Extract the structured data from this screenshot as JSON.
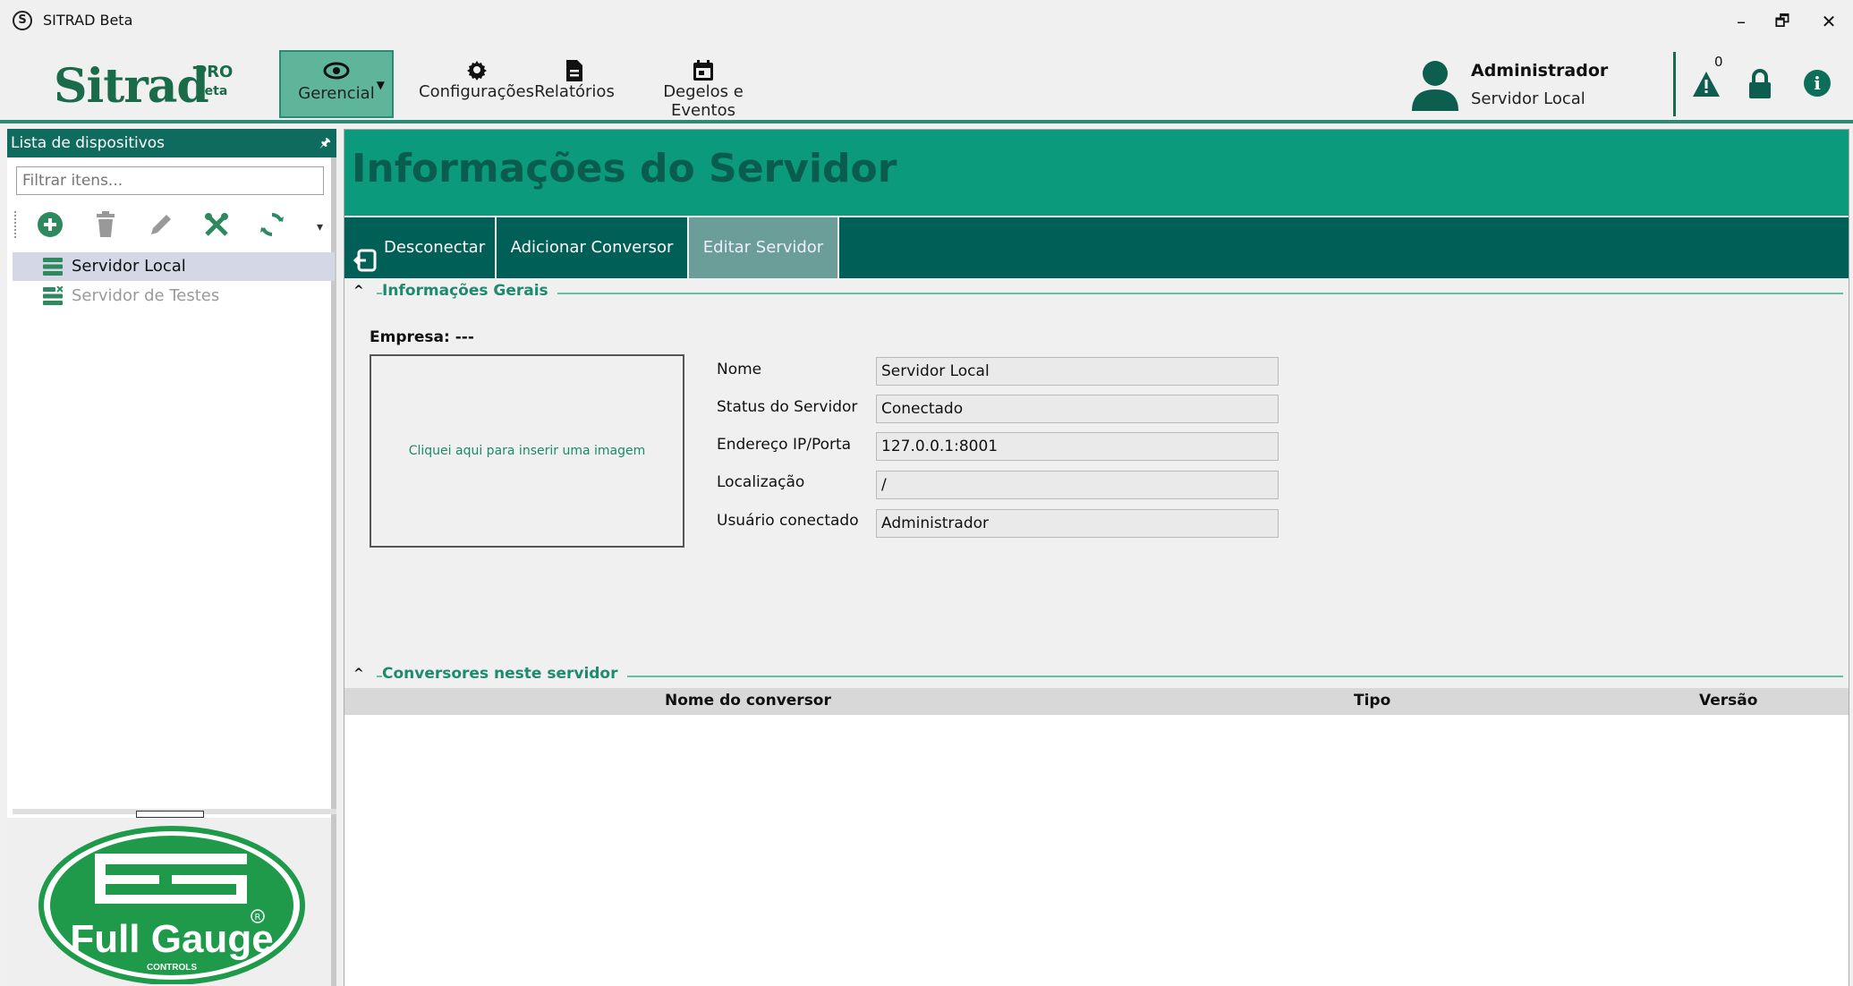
{
  "window": {
    "title": "SITRAD Beta",
    "app_icon_letter": "S",
    "minimize": "–",
    "restore": "🗗",
    "close": "✕"
  },
  "header": {
    "logo_text": "Sitrad",
    "logo_pro": "PRO",
    "logo_beta": "Beta",
    "menu": [
      {
        "label": "Gerencial",
        "icon": "eye-icon",
        "active": true
      },
      {
        "label": "Configurações",
        "icon": "gear-icon"
      },
      {
        "label": "Relatórios",
        "icon": "document-icon"
      },
      {
        "label": "Degelos e Eventos",
        "icon": "calendar-icon"
      }
    ],
    "user": {
      "name": "Administrador",
      "server": "Servidor Local"
    },
    "alert_count": "0",
    "info_glyph": "i"
  },
  "sidebar": {
    "title": "Lista de dispositivos",
    "pin_glyph": "🖈",
    "filter_placeholder": "Filtrar itens...",
    "tools": [
      "add-icon",
      "delete-icon",
      "edit-icon",
      "tools-icon",
      "sync-icon"
    ],
    "overflow_glyph": "▾",
    "items": [
      {
        "label": "Servidor Local",
        "selected": true
      },
      {
        "label": "Servidor de Testes",
        "selected": false
      }
    ],
    "brand": {
      "name": "Full Gauge",
      "sub": "CONTROLS"
    }
  },
  "main": {
    "title": "Informações do Servidor",
    "tabs": [
      {
        "label": "Desconectar"
      },
      {
        "label": "Adicionar Conversor"
      },
      {
        "label": "Editar Servidor",
        "selected": true
      }
    ],
    "section_general": "Informações Gerais",
    "company_label": "Empresa: ---",
    "image_placeholder": "Cliquei aqui para inserir uma imagem",
    "fields": [
      {
        "label": "Nome",
        "value": "Servidor Local"
      },
      {
        "label": "Status do Servidor",
        "value": "Conectado"
      },
      {
        "label": "Endereço IP/Porta",
        "value": "127.0.0.1:8001"
      },
      {
        "label": "Localização",
        "value": "/"
      },
      {
        "label": "Usuário conectado",
        "value": "Administrador"
      }
    ],
    "section_converters": "Conversores neste servidor",
    "table_columns": [
      "Nome do conversor",
      "Tipo",
      "Versão"
    ],
    "table_rows": []
  },
  "colors": {
    "brand_green": "#1a6b4a",
    "title_bar": "#0b9a7c",
    "tab_bar": "#005f56",
    "tab_selected": "#6c9e99"
  }
}
